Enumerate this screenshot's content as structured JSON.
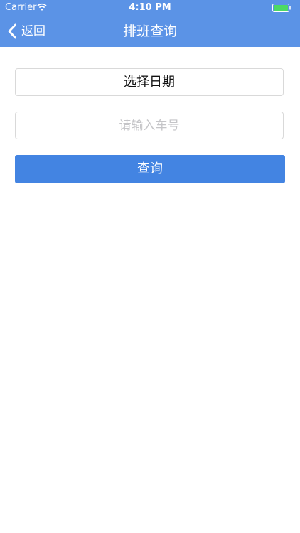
{
  "status_bar": {
    "carrier": "Carrier",
    "time": "4:10 PM"
  },
  "nav": {
    "back_label": "返回",
    "title": "排班查询"
  },
  "form": {
    "date_selector_label": "选择日期",
    "car_number_placeholder": "请输入车号",
    "car_number_value": "",
    "query_button_label": "查询"
  },
  "colors": {
    "nav_background": "#5b93e6",
    "button_background": "#4384e2",
    "battery_fill": "#4cd964"
  }
}
